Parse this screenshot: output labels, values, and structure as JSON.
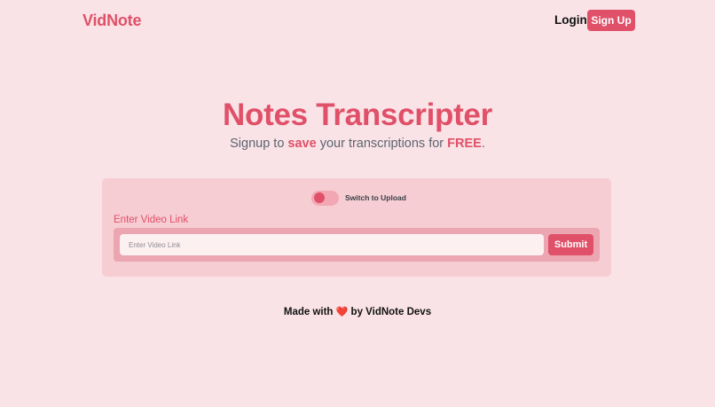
{
  "brand": "VidNote",
  "nav": {
    "login": "Login",
    "signup": "Sign Up"
  },
  "hero": {
    "title": "Notes Transcripter",
    "subtitle_pre": "Signup to ",
    "subtitle_save": "save",
    "subtitle_mid": " your transcriptions for ",
    "subtitle_free": "FREE",
    "subtitle_end": "."
  },
  "form": {
    "toggle_label": "Switch to Upload",
    "field_label": "Enter Video Link",
    "placeholder": "Enter Video Link",
    "value": "",
    "submit": "Submit"
  },
  "footer": {
    "pre": "Made with ",
    "heart_icon": "heart-icon",
    "heart": "❤️",
    "post": " by VidNote Devs"
  },
  "colors": {
    "background": "#f9e3e7",
    "accent": "#e05068",
    "card": "#f6cdd3"
  }
}
